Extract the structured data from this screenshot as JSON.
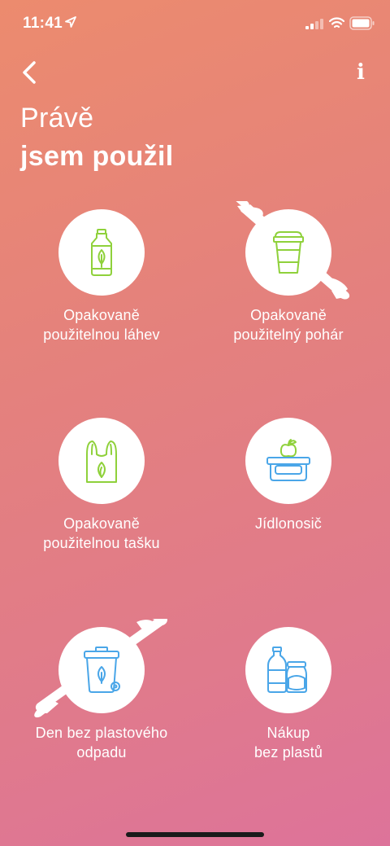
{
  "status": {
    "time": "11:41",
    "location_icon": "location-arrow-icon",
    "signal_icon": "cellular-signal-icon",
    "wifi_icon": "wifi-icon",
    "battery_icon": "battery-icon"
  },
  "nav": {
    "back_icon": "chevron-left-icon",
    "info_label": "i"
  },
  "header": {
    "title_line1": "Právě",
    "title_line2": "jsem použil"
  },
  "colors": {
    "gradient_start": "#ec8b6e",
    "gradient_end": "#dd739a",
    "icon_green": "#8fd13b",
    "icon_blue": "#4aa6e8",
    "text": "#ffffff"
  },
  "options": [
    {
      "line1": "Opakovaně",
      "line2": "použitelnou láhev",
      "icon": "bottle-icon",
      "icon_color": "green"
    },
    {
      "line1": "Opakovaně",
      "line2": "použitelný pohár",
      "icon": "cup-icon",
      "icon_color": "green"
    },
    {
      "line1": "Opakovaně",
      "line2": "použitelnou tašku",
      "icon": "bag-icon",
      "icon_color": "green"
    },
    {
      "line1": "Jídlonosič",
      "line2": "",
      "icon": "lunchbox-icon",
      "icon_color": "blue"
    },
    {
      "line1": "Den bez plastového",
      "line2": "odpadu",
      "icon": "bin-icon",
      "icon_color": "blue"
    },
    {
      "line1": "Nákup",
      "line2": "bez plastů",
      "icon": "jars-icon",
      "icon_color": "blue"
    }
  ]
}
